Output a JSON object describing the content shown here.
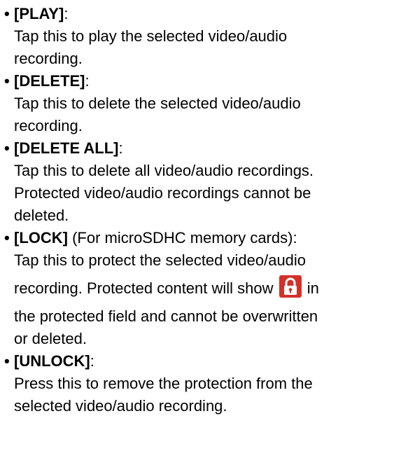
{
  "items": [
    {
      "label": "[PLAY]",
      "suffix": ":",
      "lines": [
        "Tap this to play the selected video/audio",
        "recording."
      ]
    },
    {
      "label": "[DELETE]",
      "suffix": ":",
      "lines": [
        "Tap this to delete the selected video/audio",
        "recording."
      ]
    },
    {
      "label": "[DELETE ALL]",
      "suffix": ":",
      "lines": [
        "Tap this to delete all video/audio recordings.",
        "Protected video/audio recordings cannot be",
        "deleted."
      ]
    },
    {
      "label": "[LOCK]",
      "suffix": " (For microSDHC memory cards):",
      "lines": [
        "Tap this to protect the selected video/audio"
      ],
      "icon_line_before": "recording. Protected content will show",
      "icon_line_after": "in",
      "icon": "lock-icon",
      "icon_color": "#d4302a",
      "lines_after": [
        "the protected field and cannot be overwritten",
        "or deleted."
      ]
    },
    {
      "label": "[UNLOCK]",
      "suffix": ":",
      "lines": [
        "Press this to remove the protection from the",
        "selected video/audio recording."
      ]
    }
  ]
}
